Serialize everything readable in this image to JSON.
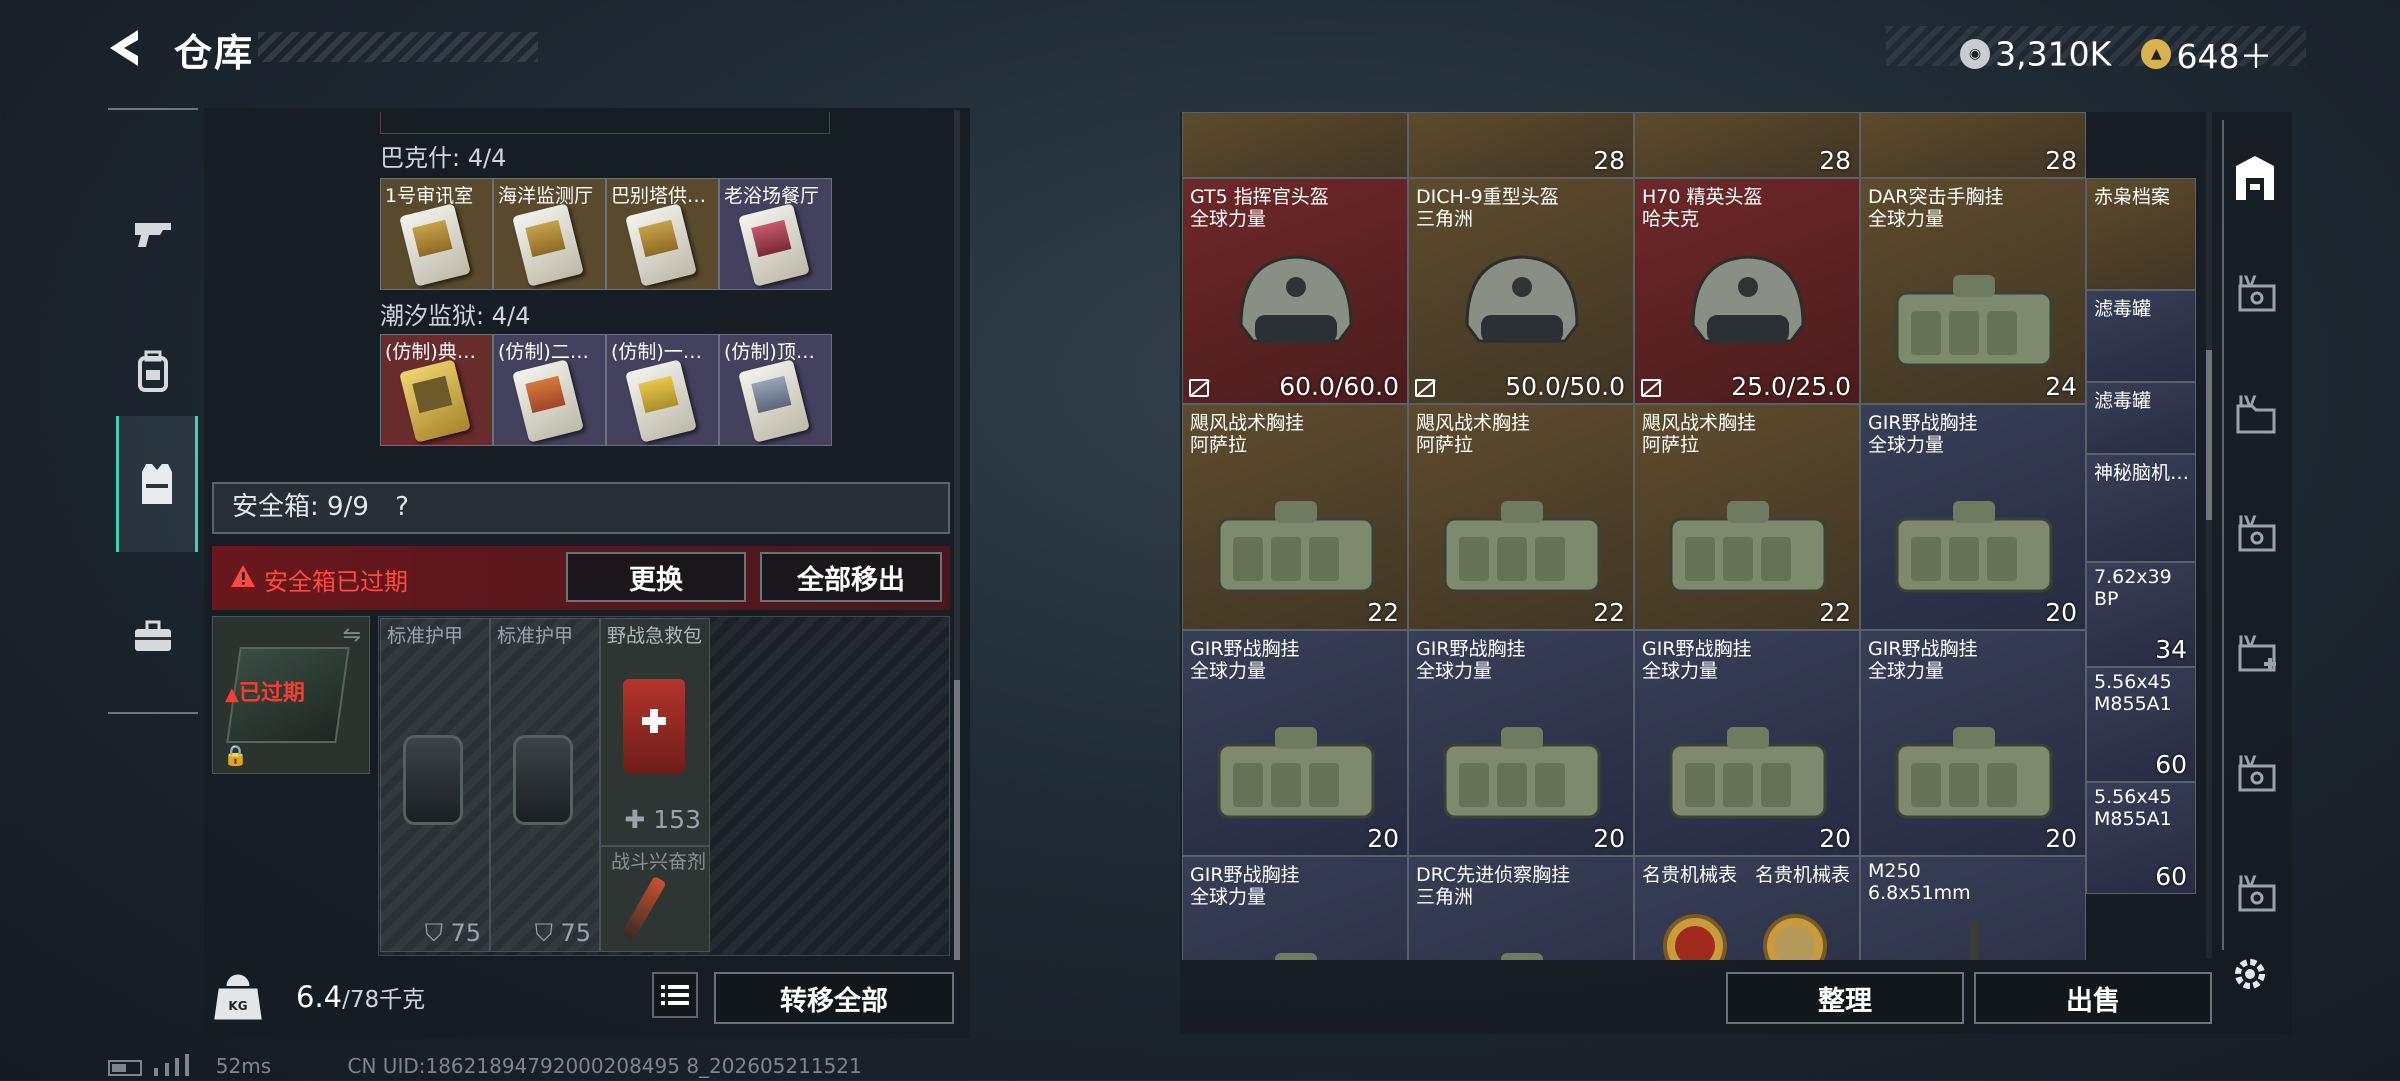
{
  "header": {
    "title": "仓库",
    "currency": [
      {
        "icon": "silver-coin-icon",
        "value": "3,310K"
      },
      {
        "icon": "gold-coin-icon",
        "value": "648＋"
      }
    ]
  },
  "rail": [
    {
      "icon": "gun-icon"
    },
    {
      "icon": "backpack-icon"
    },
    {
      "icon": "vest-icon",
      "active": true
    },
    {
      "icon": "toolbox-icon"
    }
  ],
  "groups": [
    {
      "title": "巴克什: 4/4",
      "keys": [
        "1号审讯室",
        "海洋监测厅",
        "巴别塔供…",
        "老浴场餐厅"
      ]
    },
    {
      "title": "潮汐监狱: 4/4",
      "keys": [
        "(仿制)典…",
        "(仿制)二…",
        "(仿制)一…",
        "(仿制)顶…"
      ]
    }
  ],
  "safe": {
    "label": "安全箱: 9/9",
    "help": "?",
    "expired_msg": "安全箱已过期",
    "replace": "更换",
    "move_all": "全部移出",
    "box_label": "已过期",
    "items": [
      {
        "name": "标准护甲",
        "stat": "75"
      },
      {
        "name": "标准护甲",
        "stat": "75"
      },
      {
        "name": "野战急救包",
        "stat": "153"
      },
      {
        "name": "战斗兴奋剂",
        "stat": ""
      }
    ]
  },
  "weight": {
    "current": "6.4",
    "max": "/78千克",
    "transfer_all": "转移全部"
  },
  "stash": {
    "top_stats": [
      "28",
      "28",
      "28"
    ],
    "rows": [
      [
        {
          "n1": "GT5 指挥官头盔",
          "n2": "全球力量",
          "stat": "60.0/60.0",
          "color": "red",
          "kind": "helmet"
        },
        {
          "n1": "DICH-9重型头盔",
          "n2": "三角洲",
          "stat": "50.0/50.0",
          "color": "yel",
          "kind": "helmet"
        },
        {
          "n1": "H70 精英头盔",
          "n2": "哈夫克",
          "stat": "25.0/25.0",
          "color": "red",
          "kind": "helmet"
        },
        {
          "n1": "DAR突击手胸挂",
          "n2": "全球力量",
          "stat": "24",
          "color": "yel",
          "kind": "rig"
        }
      ],
      [
        {
          "n1": "飓风战术胸挂",
          "n2": "阿萨拉",
          "stat": "22",
          "color": "yel",
          "kind": "rig"
        },
        {
          "n1": "飓风战术胸挂",
          "n2": "阿萨拉",
          "stat": "22",
          "color": "yel",
          "kind": "rig"
        },
        {
          "n1": "飓风战术胸挂",
          "n2": "阿萨拉",
          "stat": "22",
          "color": "yel",
          "kind": "rig"
        },
        {
          "n1": "GIR野战胸挂",
          "n2": "全球力量",
          "stat": "20",
          "color": "blu",
          "kind": "rig"
        }
      ],
      [
        {
          "n1": "GIR野战胸挂",
          "n2": "全球力量",
          "stat": "20",
          "color": "blu",
          "kind": "rig"
        },
        {
          "n1": "GIR野战胸挂",
          "n2": "全球力量",
          "stat": "20",
          "color": "blu",
          "kind": "rig"
        },
        {
          "n1": "GIR野战胸挂",
          "n2": "全球力量",
          "stat": "20",
          "color": "blu",
          "kind": "rig"
        },
        {
          "n1": "GIR野战胸挂",
          "n2": "全球力量",
          "stat": "20",
          "color": "blu",
          "kind": "rig"
        }
      ],
      [
        {
          "n1": "GIR野战胸挂",
          "n2": "全球力量",
          "stat": "",
          "color": "blu",
          "kind": "rig"
        },
        {
          "n1": "DRC先进侦察胸挂",
          "n2": "三角洲",
          "stat": "",
          "color": "blu",
          "kind": "rig"
        },
        {
          "n1": "名贵机械表",
          "n2": "",
          "stat": "",
          "color": "blu",
          "kind": "watch2",
          "n1b": "名贵机械表"
        },
        {
          "n1": "M250",
          "n2": "6.8x51mm",
          "stat": "",
          "color": "blu",
          "kind": "ammo"
        }
      ]
    ],
    "side": [
      {
        "n1": "赤枭档案",
        "n2": "",
        "stat": "",
        "color": "yel"
      },
      {
        "n1": "滤毒罐",
        "n2": "",
        "stat": "",
        "color": "blu"
      },
      {
        "n1": "滤毒罐",
        "n2": "",
        "stat": "",
        "color": "blu"
      },
      {
        "n1": "神秘脑机…",
        "n2": "",
        "stat": "",
        "color": "blu"
      },
      {
        "n1": "7.62x39",
        "n2": "BP",
        "stat": "34",
        "color": "blu"
      },
      {
        "n1": "5.56x45",
        "n2": "M855A1",
        "stat": "60",
        "color": "blu"
      },
      {
        "n1": "5.56x45",
        "n2": "M855A1",
        "stat": "60",
        "color": "blu"
      }
    ],
    "organize": "整理",
    "sell": "出售"
  },
  "status": {
    "ping": "52ms",
    "uid": "CN UID:18621894792000208495 8_202605211521"
  }
}
